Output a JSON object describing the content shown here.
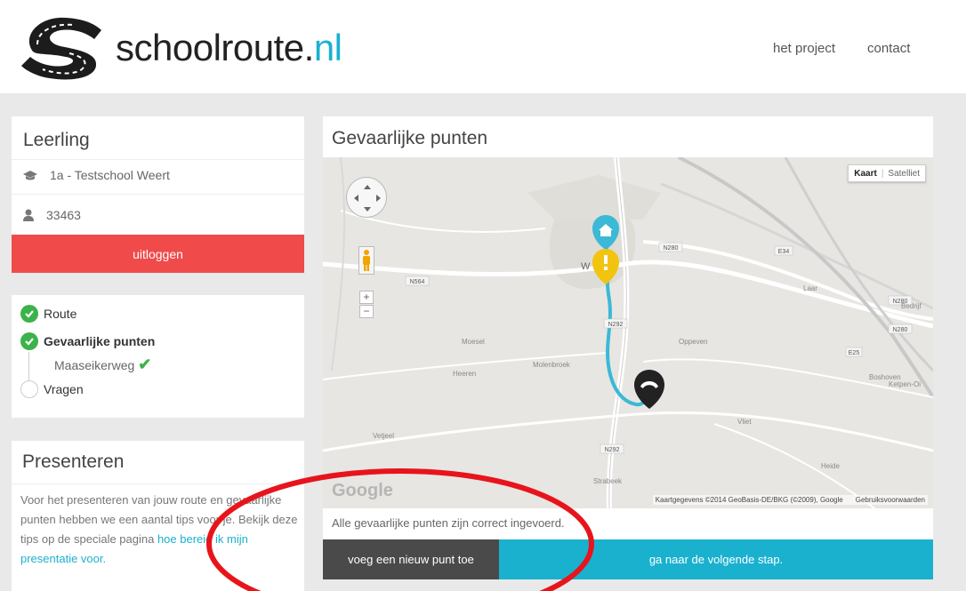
{
  "header": {
    "brand_main": "schoolroute.",
    "brand_tld": "nl",
    "nav": [
      "het project",
      "contact"
    ]
  },
  "leerling": {
    "title": "Leerling",
    "school": "1a - Testschool Weert",
    "student_id": "33463",
    "logout_label": "uitloggen"
  },
  "steps": {
    "route": "Route",
    "gevaarlijke_punten": "Gevaarlijke punten",
    "substep": "Maaseikerweg",
    "vragen": "Vragen"
  },
  "presenteren": {
    "title": "Presenteren",
    "text": "Voor het presenteren van jouw route en gevaarlijke punten hebben we een aantal tips voor je. Bekijk deze tips op de speciale pagina ",
    "link": "hoe bereid ik mijn presentatie voor."
  },
  "gevaar": {
    "title": "Gevaarlijke punten",
    "map_type_map": "Kaart",
    "map_type_satellite": "Satelliet",
    "attribution": "Kaartgegevens ©2014 GeoBasis-DE/BKG (©2009), Google",
    "terms": "Gebruiksvoorwaarden",
    "google_logo": "Google",
    "status": "Alle gevaarlijke punten zijn correct ingevoerd.",
    "add_button": "voeg een nieuw punt toe",
    "next_button": "ga naar de volgende stap."
  },
  "map_labels": {
    "weert": "W",
    "roads": [
      "N564",
      "N280",
      "N292",
      "N292",
      "E34",
      "N280",
      "E25",
      "N280"
    ],
    "places": [
      "Moesel",
      "Molenbroek",
      "Heeren",
      "Vetjeel",
      "Strabeek",
      "Oppeven",
      "Vliet",
      "Boshoven",
      "Ketpen-Oi",
      "Bedrijf",
      "Laar",
      "Heide"
    ]
  },
  "colors": {
    "accent": "#1ab1cf",
    "logout": "#f04a4b",
    "check": "#3bb34a",
    "route": "#3bb9d6",
    "annotation": "#e8141c"
  }
}
